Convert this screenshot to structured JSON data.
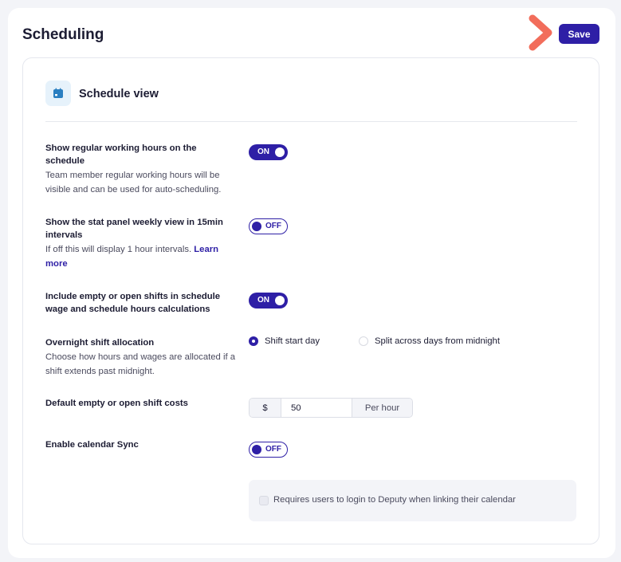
{
  "page": {
    "title": "Scheduling",
    "save_label": "Save"
  },
  "section": {
    "title": "Schedule view",
    "icon": "calendar-icon"
  },
  "settings": {
    "working_hours": {
      "label": "Show regular working hours on the schedule",
      "description": "Team member regular working hours will be visible and can be used for auto-scheduling.",
      "toggle": "ON"
    },
    "stat_panel": {
      "label": "Show the stat panel weekly view in 15min intervals",
      "description": "If off this will display 1 hour intervals.",
      "link": "Learn more",
      "toggle": "OFF"
    },
    "empty_shifts": {
      "label": "Include empty or open shifts in schedule wage and schedule hours calculations",
      "toggle": "ON"
    },
    "overnight": {
      "label": "Overnight shift allocation",
      "description": "Choose how hours and wages are allocated if a shift extends past midnight.",
      "options": [
        "Shift start day",
        "Split across days from midnight"
      ],
      "selected": "Shift start day"
    },
    "default_cost": {
      "label": "Default empty or open shift costs",
      "currency": "$",
      "value": "50",
      "unit": "Per hour"
    },
    "calendar_sync": {
      "label": "Enable calendar Sync",
      "toggle": "OFF",
      "checkbox_label": "Requires users to login to Deputy when linking their calendar",
      "checked": false
    }
  },
  "colors": {
    "accent": "#2e1fa6",
    "arrow": "#f26d5b",
    "icon_bg": "#e6f2fb",
    "icon": "#2a7fc1"
  }
}
